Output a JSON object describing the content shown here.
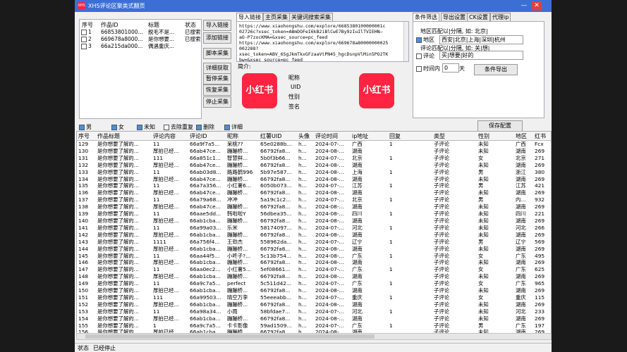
{
  "window": {
    "title": "XHS评论区聚类式翻页",
    "logo_text": "XHS"
  },
  "left_table": {
    "headers": [
      "序号",
      "作品ID",
      "标题",
      "状态"
    ],
    "rows": [
      {
        "idx": "1",
        "id": "66853801000...",
        "title": "脱毛不是...",
        "status": "已搜索"
      },
      {
        "idx": "2",
        "id": "669678a8000...",
        "title": "是你想要...",
        "status": "已搜索"
      },
      {
        "idx": "3",
        "id": "66a215da000...",
        "title": "偶遇重庆...",
        "status": ""
      }
    ]
  },
  "buttons": {
    "import_link": "导入链接",
    "add_link": "添加链接",
    "script_collect": "脚本采集",
    "detail_fetch": "详细获取",
    "pause_collect": "暂停采集",
    "resume_collect": "恢复采集",
    "stop_collect": "停止采集",
    "save_config": "保存配置",
    "condition_export": "条件导出"
  },
  "center_tabs": [
    "导入链接",
    "主页采集",
    "关键词搜索采集"
  ],
  "right_tabs": [
    "条件筛选",
    "导出设置",
    "CK设置",
    "代理ip"
  ],
  "urls": "https://www.xiaohongshu.com/explore/6685380100000001c\n02726c?xsec_token=ABmDOFeI6kB2iBlCwE7By9zIuIlTVIEHN—\naO-P7zocKMA=&xsec_source=pc_feed\nhttps://www.xiaohongshu.com/explore/669678a80000000025\n002288?\nxsec_token=ABV_6SgJkmTkxGFzaaVtPN45_hgcDsnpVlMin5PO2TK\nbw=&xsec_source=pc_feed",
  "intro_label": "简介:",
  "profile_fields": [
    "昵称",
    "UID",
    "性别",
    "签名"
  ],
  "xhs_logo_text": "小红书",
  "filters": {
    "region_hint": "地区匹配以|分隔, 如: 北京|",
    "region_label": "地区",
    "region_value": "西安|北京|上海|深圳|杭州",
    "comment_hint": "评论匹配以|分隔, 如: 关|想|",
    "comment_label": "评论",
    "comment_value": "买|想要|好的",
    "time_label": "时间内",
    "time_value": "0",
    "time_unit": "天"
  },
  "checkboxes": [
    {
      "label": "男",
      "on": true
    },
    {
      "label": "女",
      "on": true
    },
    {
      "label": "未知",
      "on": true
    },
    {
      "label": "去除重复",
      "on": false
    },
    {
      "label": "删除",
      "on": true
    },
    {
      "label": "详细",
      "on": true
    }
  ],
  "main_headers": [
    "序号",
    "作品标题",
    "评论内容",
    "评论ID",
    "昵称",
    "红薯UID",
    "头像",
    "评论时间",
    "ip地址",
    "回复",
    "类型",
    "性别",
    "地区",
    "红书"
  ],
  "main_rows": [
    [
      "129",
      "是你想要了解的...",
      "11",
      "66a9f7a5...",
      "呆桃??",
      "65e0288b...",
      "h...",
      "2024-07-...",
      "广西",
      "1",
      "子评论",
      "未知",
      "广西",
      "Fcx"
    ],
    [
      "130",
      "是你想要了解的...",
      "厚拍已经...",
      "66ab47ce...",
      "蹦蹦桥...",
      "66792fa8...",
      "h...",
      "2024-08-...",
      "湖南",
      "",
      "子评论",
      "未知",
      "湖南",
      "269"
    ],
    [
      "131",
      "是你想要了解的...",
      "111",
      "66a851c1...",
      "智慧鲜...",
      "5b0f3b66...",
      "h...",
      "2024-07-...",
      "北京",
      "1",
      "子评论",
      "女",
      "北京",
      "271"
    ],
    [
      "132",
      "是你想要了解的...",
      "厚拍已经...",
      "66ab47ce...",
      "蹦蹦桥...",
      "66792fa8...",
      "h...",
      "2024-08-...",
      "湖南",
      "",
      "子评论",
      "未知",
      "湖南",
      "269"
    ],
    [
      "133",
      "是你想要了解的...",
      "11",
      "66ab03d8...",
      "路路鹤996",
      "5b97e587...",
      "h...",
      "2024-08-...",
      "上海",
      "1",
      "子评论",
      "男",
      "浙江",
      "380"
    ],
    [
      "134",
      "是你想要了解的...",
      "厚拍已经...",
      "66ab47ce...",
      "蹦蹦桥...",
      "66792fa8...",
      "h...",
      "2024-08-...",
      "湖南",
      "",
      "子评论",
      "未知",
      "湖南",
      "269"
    ],
    [
      "135",
      "是你想要了解的...",
      "11",
      "66a7a356...",
      "小红薯6...",
      "6050b073...",
      "h...",
      "2024-07-...",
      "江苏",
      "1",
      "子评论",
      "男",
      "江苏",
      "421"
    ],
    [
      "136",
      "是你想要了解的...",
      "厚拍已经...",
      "66ab47ce...",
      "蹦蹦桥...",
      "66792fa8...",
      "h...",
      "2024-08-...",
      "湖南",
      "",
      "子评论",
      "未知",
      "湖南",
      "269"
    ],
    [
      "137",
      "是你想要了解的...",
      "11",
      "66a79a68...",
      "冲冲",
      "5a19c1c2...",
      "h...",
      "2024-07-...",
      "北京",
      "1",
      "子评论",
      "男",
      "内...",
      "932"
    ],
    [
      "138",
      "是你想要了解的...",
      "厚拍已经...",
      "66ab47ce...",
      "蹦蹦桥...",
      "66792fa8...",
      "h...",
      "2024-08-...",
      "湖南",
      "",
      "子评论",
      "未知",
      "湖南",
      "269"
    ],
    [
      "139",
      "是你想要了解的...",
      "11",
      "66aae5dd...",
      "韩啦啦Y",
      "56dbea35...",
      "h...",
      "2024-08-...",
      "四川",
      "1",
      "子评论",
      "未知",
      "四川",
      "221"
    ],
    [
      "140",
      "是你想要了解的...",
      "厚拍已经...",
      "66ab1cba...",
      "蹦蹦桥...",
      "66792fa8...",
      "h...",
      "2024-08-...",
      "湖南",
      "",
      "子评论",
      "未知",
      "湖南",
      "269"
    ],
    [
      "141",
      "是你想要了解的...",
      "11",
      "66a99a03...",
      "乐米",
      "58174097...",
      "h...",
      "2024-07-...",
      "河北",
      "1",
      "子评论",
      "未知",
      "河北",
      "266"
    ],
    [
      "142",
      "是你想要了解的...",
      "厚拍已经...",
      "66ab1cba...",
      "蹦蹦桥...",
      "66792fa8...",
      "h...",
      "2024-08-...",
      "湖南",
      "",
      "子评论",
      "未知",
      "湖南",
      "269"
    ],
    [
      "143",
      "是你想要了解的...",
      "1111",
      "66a756f4...",
      "王劲杰",
      "558962da...",
      "h...",
      "2024-07-...",
      "辽宁",
      "1",
      "子评论",
      "男",
      "辽宁",
      "569"
    ],
    [
      "144",
      "是你想要了解的...",
      "厚拍已经...",
      "66ab1cba...",
      "蹦蹦桥...",
      "66792fa8...",
      "h...",
      "2024-08-...",
      "湖南",
      "",
      "子评论",
      "未知",
      "湖南",
      "269"
    ],
    [
      "145",
      "是你想要了解的...",
      "11",
      "66aa44f5...",
      "小咚子?...",
      "5c13b754...",
      "h...",
      "2024-08-...",
      "广东",
      "1",
      "子评论",
      "女",
      "广东",
      "495"
    ],
    [
      "146",
      "是你想要了解的...",
      "厚拍已经...",
      "66ab1cba...",
      "蹦蹦桥...",
      "66792fa8...",
      "h...",
      "2024-08-...",
      "湖南",
      "",
      "子评论",
      "未知",
      "湖南",
      "269"
    ],
    [
      "147",
      "是你想要了解的...",
      "11",
      "66aa0ec2...",
      "小红薯5...",
      "5ef08661...",
      "h...",
      "2024-07-...",
      "广东",
      "1",
      "子评论",
      "女",
      "广东",
      "625"
    ],
    [
      "148",
      "是你想要了解的...",
      "厚拍已经...",
      "66ab1cba...",
      "蹦蹦桥...",
      "66792fa8...",
      "h...",
      "2024-08-...",
      "湖南",
      "",
      "子评论",
      "未知",
      "湖南",
      "269"
    ],
    [
      "149",
      "是你想要了解的...",
      "11",
      "66a9c7a5...",
      "perfect",
      "5c511d42...",
      "h...",
      "2024-07-...",
      "广东",
      "1",
      "子评论",
      "女",
      "广东",
      "965"
    ],
    [
      "150",
      "是你想要了解的...",
      "厚拍已经...",
      "66ab1cba...",
      "蹦蹦桥...",
      "66792fa8...",
      "h...",
      "2024-08-...",
      "湖南",
      "",
      "子评论",
      "未知",
      "湖南",
      "269"
    ],
    [
      "151",
      "是你想要了解的...",
      "111",
      "66a99503...",
      "晴空万李",
      "55eeeabb...",
      "h...",
      "2024-07-...",
      "重庆",
      "1",
      "子评论",
      "女",
      "重庆",
      "115"
    ],
    [
      "152",
      "是你想要了解的...",
      "厚拍已经...",
      "66ab1cba...",
      "蹦蹦桥...",
      "66792fa8...",
      "h...",
      "2024-08-...",
      "湖南",
      "",
      "子评论",
      "未知",
      "湖南",
      "269"
    ],
    [
      "153",
      "是你想要了解的...",
      "11",
      "66a98a34...",
      "小雨",
      "58bfdae7...",
      "h...",
      "2024-07-...",
      "河北",
      "1",
      "子评论",
      "未知",
      "河北",
      "233"
    ],
    [
      "154",
      "是你想要了解的...",
      "厚拍已经...",
      "66ab1cba...",
      "蹦蹦桥...",
      "66792fa8...",
      "h...",
      "2024-08-...",
      "湖南",
      "",
      "子评论",
      "未知",
      "湖南",
      "269"
    ],
    [
      "155",
      "是你想要了解的...",
      "1",
      "66a9c7a5...",
      "卡卡影像",
      "59ad1509...",
      "h...",
      "2024-07-...",
      "广东",
      "1",
      "子评论",
      "男",
      "广东",
      "197"
    ],
    [
      "156",
      "是你想要了解的...",
      "厚拍已经...",
      "66ab1cba...",
      "蹦蹦桥...",
      "66792fa8...",
      "h...",
      "2024-08-...",
      "湖南",
      "",
      "子评论",
      "未知",
      "湖南",
      "269"
    ],
    [
      "157",
      "是你想要了解的...",
      "11[微笑R]",
      "66a748bb...",
      "P.",
      "5bf2f36e8...",
      "h...",
      "2024-07-...",
      "北京",
      "1",
      "子评论",
      "男",
      "北京",
      "425"
    ]
  ],
  "status": {
    "label": "状态",
    "value": "已经停止"
  }
}
